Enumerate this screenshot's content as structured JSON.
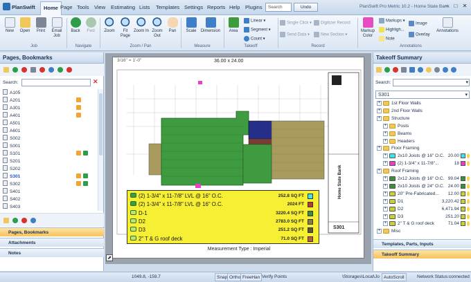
{
  "app": {
    "name": "PlanSwift",
    "window_title": "PlanSwift Pro Metric 10.2 - Home State Bank"
  },
  "menu": [
    "Home",
    "Page",
    "Tools",
    "View",
    "Estimating",
    "Lists",
    "Templates",
    "Settings",
    "Reports",
    "Help",
    "Plugins"
  ],
  "search": {
    "value": "Search"
  },
  "undo_label": "Undo",
  "ribbon": {
    "job": [
      "New",
      "Open",
      "Print",
      "Email Job"
    ],
    "job_label": "Job",
    "navigate": [
      "Back",
      "Fwd"
    ],
    "navigate_label": "Navigate",
    "zoom": [
      "Zoom",
      "Fit Page",
      "Zoom In",
      "Zoom Out",
      "Pan"
    ],
    "zoom_label": "Zoom / Pan",
    "measure": [
      "Scale",
      "Dimension"
    ],
    "measure_label": "Measure",
    "takeoff_area": "Area",
    "takeoff_small": [
      "Linear",
      "Segment",
      "Count"
    ],
    "takeoff_label": "Takeoff",
    "record_small": [
      "Single Click",
      "Send Data",
      "Digitizer Record",
      "New Section"
    ],
    "record_label": "Record",
    "markup_color": "Markup Color",
    "annot_small": [
      "Markups",
      "Highligh...",
      "Note"
    ],
    "annot_big": [
      "Image",
      "Overlay",
      "Annotations"
    ],
    "annotations_label": "Annotations"
  },
  "left_panel": {
    "title": "Pages, Bookmarks",
    "search_label": "Search:",
    "pages": [
      "A105",
      "A201",
      "A301",
      "A401",
      "A501",
      "A601",
      "S002",
      "S001",
      "S101",
      "S201",
      "S202",
      "S301",
      "S302",
      "S401",
      "S402",
      "S403"
    ],
    "selected_page": "S301",
    "bars": [
      "Pages, Bookmarks",
      "Attachments",
      "Notes"
    ]
  },
  "drawing": {
    "scale_text": "3/16\" = 1'-0\"",
    "sheet_size": "36.00 x 24.00",
    "measurement_type": "Measurement Type : Imperial",
    "title_block_name": "Home State Bank",
    "sheet_no": "S301",
    "legend": [
      {
        "label": "(2) 1-3/4\" x 11-7/8\" LVL @ 16\" O.C.",
        "value": "252.8 SQ FT",
        "color": "#39e6f0"
      },
      {
        "label": "(2) 1-3/4\" x 11-7/8\" LVL @ 16\" O.C.",
        "value": "2024 FT",
        "color": "#c0392b"
      },
      {
        "label": "D-1",
        "value": "3220.4 SQ FT",
        "color": "#3a8f3a"
      },
      {
        "label": "D2",
        "value": "2783.0 SQ FT",
        "color": "#8a7a3d"
      },
      {
        "label": "D3",
        "value": "251.2 SQ FT",
        "color": "#5b5630"
      },
      {
        "label": "2\" T & G roof deck",
        "value": "71.0 SQ FT",
        "color": "#c55a3b"
      }
    ]
  },
  "right_panel": {
    "title": "Takeoff Summary",
    "search_label": "Search:",
    "dropdown_value": "S301",
    "tree": [
      {
        "label": "1st Floor Walls",
        "indent": 1,
        "kind": "folder"
      },
      {
        "label": "2nd Floor Walls",
        "indent": 1,
        "kind": "folder"
      },
      {
        "label": "Structure",
        "indent": 1,
        "kind": "folder"
      },
      {
        "label": "Posts",
        "indent": 2,
        "kind": "folder"
      },
      {
        "label": "Beams",
        "indent": 2,
        "kind": "folder"
      },
      {
        "label": "Headers",
        "indent": 2,
        "kind": "folder"
      },
      {
        "label": "Floor Framing",
        "indent": 1,
        "kind": "folder"
      },
      {
        "label": "2x10 Joists @ 16\" O.C.",
        "indent": 2,
        "kind": "item",
        "value": "20.00",
        "color": "#39e6f0"
      },
      {
        "label": "(2) 1-3/4\" x 11-7/8\"...",
        "indent": 2,
        "kind": "item",
        "value": "18",
        "color": "#e83ec8"
      },
      {
        "label": "Roof Framing",
        "indent": 1,
        "kind": "folder"
      },
      {
        "label": "2x12 Joists @ 16\" O.C.",
        "indent": 2,
        "kind": "item",
        "value": "99.04",
        "color": "#3a8f3a"
      },
      {
        "label": "2x10 Joists @ 24\" O.C.",
        "indent": 2,
        "kind": "item",
        "value": "24.00",
        "color": "#3a8f3a"
      },
      {
        "label": "20\" Pre-Fabricated...",
        "indent": 2,
        "kind": "item",
        "value": "12.00",
        "color": "#c8d13a"
      },
      {
        "label": "D1",
        "indent": 2,
        "kind": "item",
        "value": "3,220.42",
        "color": "#c8d13a"
      },
      {
        "label": "D2",
        "indent": 2,
        "kind": "item",
        "value": "6,471.94",
        "color": "#c8d13a"
      },
      {
        "label": "D3",
        "indent": 2,
        "kind": "item",
        "value": "251.20",
        "color": "#c8d13a"
      },
      {
        "label": "2\" T & G roof deck",
        "indent": 2,
        "kind": "item",
        "value": "71.04",
        "color": "#c8d13a"
      },
      {
        "label": "Misc",
        "indent": 1,
        "kind": "folder"
      }
    ],
    "bars": [
      "Templates, Parts, Inputs",
      "Takeoff Summary"
    ]
  },
  "status": {
    "coords": "1049.8, -159.7",
    "buttons": [
      "Snap",
      "Ortho",
      "FreeHan",
      "Verify Points"
    ],
    "storage": "\\Storages\\Local\\Jo",
    "autoscroll": "AutoScroll",
    "network": "Network Status:connected"
  }
}
